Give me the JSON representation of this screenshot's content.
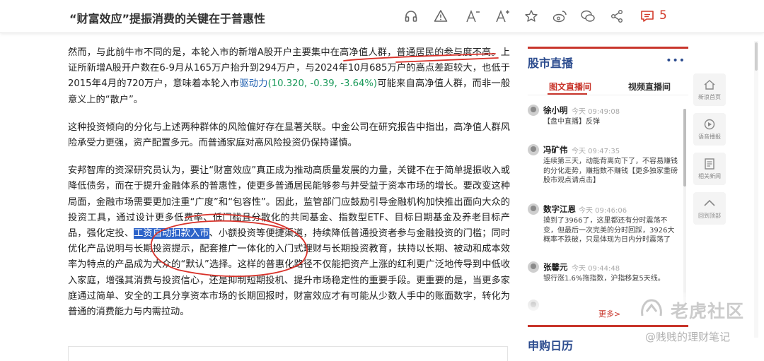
{
  "header": {
    "title": "“财富效应”提振消费的关键在于普惠性",
    "comment_count": "5",
    "tools": [
      "headphones-icon",
      "warning-icon",
      "font-decrease-icon",
      "font-increase-icon",
      "star-icon",
      "weibo-icon",
      "wechat-icon",
      "share-icon",
      "comment-icon"
    ]
  },
  "article": {
    "p1": {
      "a": "然而，与此前牛市不同的是，本轮入市的新增A股开户主要集中在高净值人群，普通居民的参与度不高。上证所新增A股开户数在6-9月从165万户抬升到294万户，与2024年10月685万户的高点差距较大，也低于2015年4月的720万户，意味着本轮入市",
      "stock": "驱动力",
      "quote": "(10.320, -0.39, -3.64%)",
      "b": "可能来自高净值人群，而非一般意义上的“散户”。"
    },
    "p2": "这种投资倾向的分化与上述两种群体的风险偏好存在显著关联。中金公司在研究报告中指出，高净值人群风险承受力更强，资产配置多元。而普通家庭对高风险投资仍保持谨慎。",
    "p3": {
      "a": "安邦智库的资深研究员认为，要让“财富效应”真正成为推动高质量发展的力量，关键不在于简单提振收入或降低债务，而在于提升金融体系的普惠性，使更多普通居民能够参与并受益于资本市场的增长。要改变这种局面，金融市场需要更加注重“广度”和“包容性”。因此，监管部门应鼓励引导金融机构加快推出面向大众的投资工具，通过设计更多低费率、低门槛且分散化的共同基金、指数型ETF、目标日期基金及养老目标产品，强化定投、",
      "highlight": "工资自动扣款入市",
      "b": "、小额投资等便捷渠道，持续降低普通投资者参与金融投资的门槛；同时优化产品说明与长期投资提示，配套推广一体化的入门式理财与长期投资教育，扶持以长期、被动和成本效率为特点的产品成为大众的“默认”选择。这样的普惠化路径不仅能把资产上涨的红利更广泛地传导到中低收入家庭，增强其消费与投资信心，还是抑制短期投机、提升市场稳定性的重要手段。更重要的是，当更多家庭通过简单、安全的工具分享资本市场的长期回报时，财富效应才有可能从少数人手中的账面数字，转化为普通的消费能力与内需拉动。"
    }
  },
  "sidebar": {
    "section_title": "股市直播",
    "more_dots": "•••",
    "tabs": [
      "图文直播间",
      "视频直播间"
    ],
    "feed": [
      {
        "name": "徐小明",
        "time": "今天 09:49:08",
        "body": "【盘中直播】反弹"
      },
      {
        "name": "冯矿伟",
        "time": "今天 09:47:35",
        "body": "连续第三天，动能背离向下了，不容易赚钱的分化走势，赚指数不赚钱【更多独家重磅股市观点请点击】"
      },
      {
        "name": "数字江恩",
        "time": "今天 09:46:06",
        "body": "摸到了3966了，这里都还有分时震荡不变，但最后一次完美的分时回踩，3926大概率不跌破，只是体现为日内分时震荡了"
      },
      {
        "name": "张馨元",
        "time": "今天 09:44:48",
        "body": "银行涨1.6%拖指数，沪指移复5天线。"
      },
      {
        "name": "",
        "time": "",
        "body": ""
      }
    ],
    "more_label": "更多>",
    "section2_title": "申购日历"
  },
  "rightnav": [
    {
      "icon": "home-icon",
      "label": "新浪首页"
    },
    {
      "icon": "audio-icon",
      "label": "语音播报"
    },
    {
      "icon": "news-icon",
      "label": "相关新闻"
    },
    {
      "icon": "back-to-top-icon",
      "label": "回到顶部"
    }
  ],
  "watermark": {
    "brand": "老虎社区",
    "author": "@贱贱的理财笔记"
  },
  "colors": {
    "accent_red": "#c8352b",
    "navy": "#2b4b8e",
    "stock_link": "#1f5fb0",
    "highlight_bg": "#2c63c9"
  }
}
